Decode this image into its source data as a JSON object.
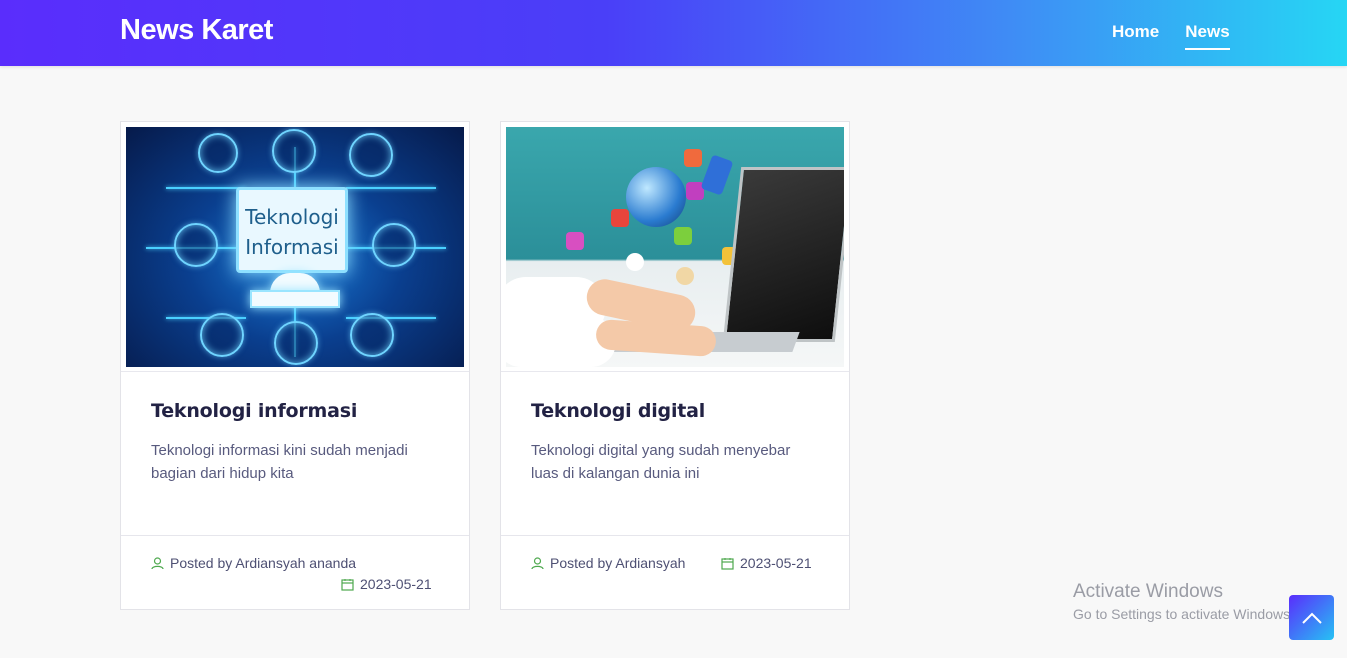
{
  "header": {
    "brand": "News Karet",
    "nav": [
      {
        "label": "Home",
        "active": false
      },
      {
        "label": "News",
        "active": true
      }
    ],
    "gradient": [
      "#5a2dfc",
      "#26d6f4"
    ]
  },
  "cards": [
    {
      "image_alt": "Teknologi Informasi illustration",
      "image_text_line1": "Teknologi",
      "image_text_line2": "Informasi",
      "title": "Teknologi informasi",
      "excerpt": "Teknologi informasi kini sudah menjadi bagian dari hidup kita",
      "author": "Posted by Ardiansyah ananda",
      "date": "2023-05-21"
    },
    {
      "image_alt": "Digital technology laptop illustration",
      "title": "Teknologi digital",
      "excerpt": "Teknologi digital yang sudah menyebar luas di kalangan dunia ini",
      "author": "Posted by Ardiansyah",
      "date": "2023-05-21"
    }
  ],
  "watermark": {
    "line1": "Activate Windows",
    "line2": "Go to Settings to activate Windows."
  },
  "icons": {
    "author": "user-icon",
    "date": "calendar-icon",
    "scroll": "chevron-up-icon"
  },
  "accent": "#4ea84e"
}
